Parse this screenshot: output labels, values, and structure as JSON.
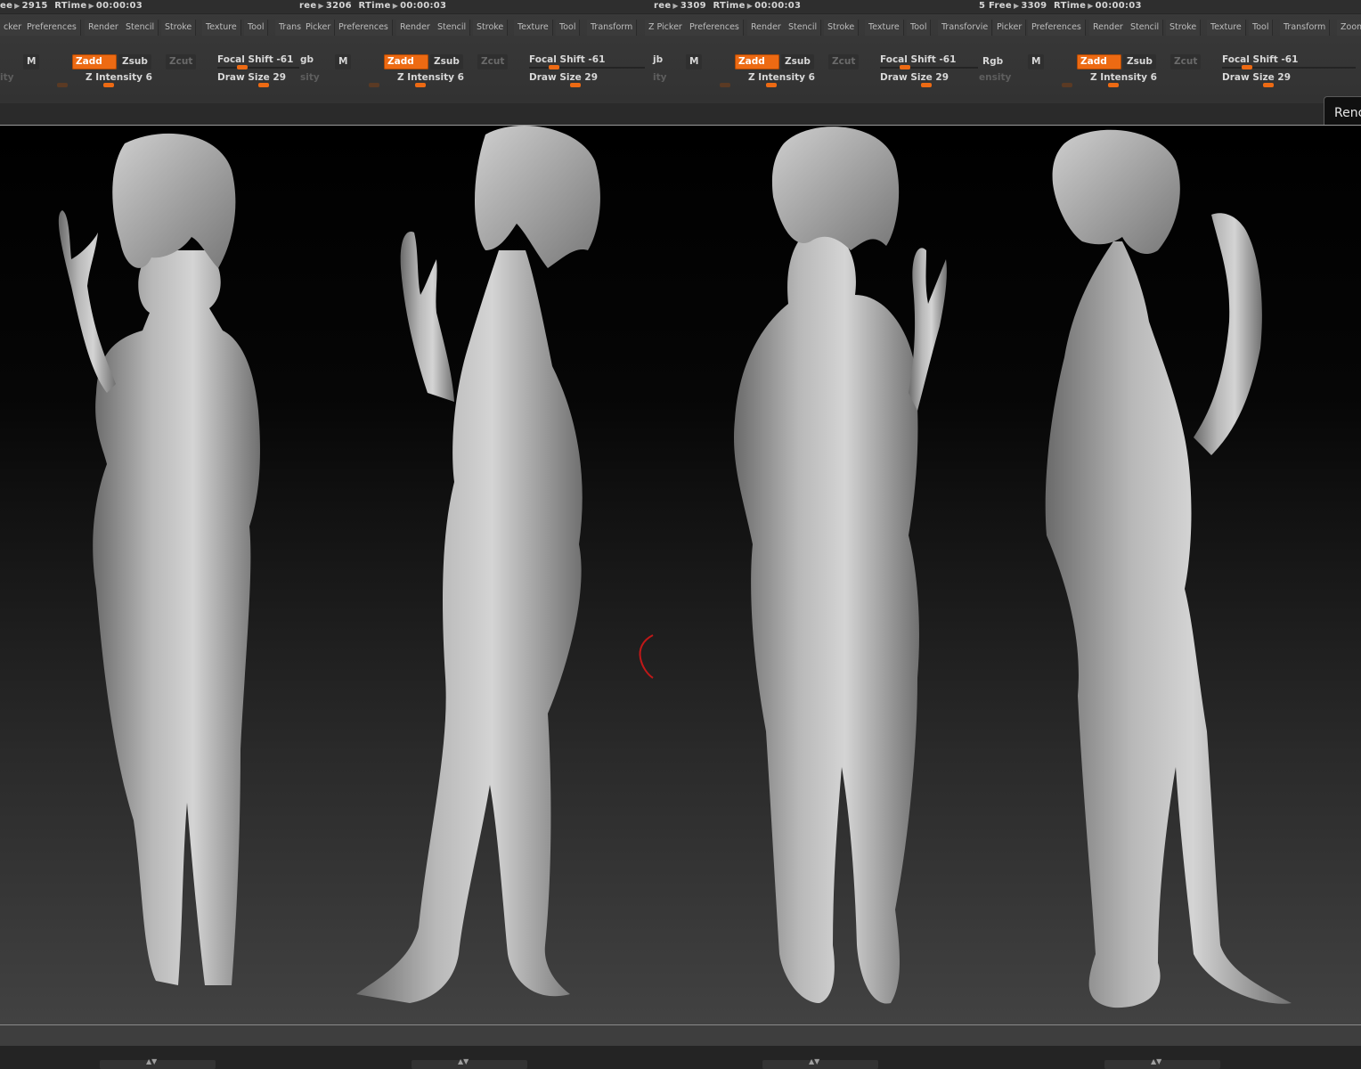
{
  "status": [
    {
      "free": "ee",
      "count": "2915",
      "rtime_label": "RTime",
      "time": "00:00:03"
    },
    {
      "free": "ree",
      "count": "3206",
      "rtime_label": "RTime",
      "time": "00:00:03"
    },
    {
      "free": "ree",
      "count": "3309",
      "rtime_label": "RTime",
      "time": "00:00:03"
    },
    {
      "free": "5 Free",
      "count": "3309",
      "rtime_label": "RTime",
      "time": "00:00:03"
    }
  ],
  "menus": [
    [
      "cker",
      "Preferences",
      "Render",
      "Stencil",
      "Stroke",
      "Texture",
      "Tool",
      "Trans"
    ],
    [
      "Picker",
      "Preferences",
      "Render",
      "Stencil",
      "Stroke",
      "Texture",
      "Tool",
      "Transform"
    ],
    [
      "Z Picker",
      "Preferences",
      "Render",
      "Stencil",
      "Stroke",
      "Texture",
      "Tool",
      "Transforvie"
    ],
    [
      "Picker",
      "Preferences",
      "Render",
      "Stencil",
      "Stroke",
      "Texture",
      "Tool",
      "Transform",
      "Zoom"
    ]
  ],
  "controls": {
    "rgb_partial": [
      "gb",
      "jb",
      "Rgb"
    ],
    "m_label": "M",
    "zadd_label": "Zadd",
    "zsub_label": "Zsub",
    "zcut_label": "Zcut",
    "focal_shift_label": "Focal Shift",
    "focal_shift_value": "-61",
    "z_intensity_label": "Z Intensity",
    "z_intensity_value": "6",
    "draw_size_label": "Draw Size",
    "draw_size_value": "29",
    "faded_left": [
      "ity",
      "sity",
      "ity",
      "ensity"
    ]
  },
  "render_button": "Renc",
  "colors": {
    "accent": "#ed6a13",
    "viewport_top": "#000000",
    "viewport_bottom": "#424242"
  },
  "viewport_views": [
    "front-view",
    "left-side-view",
    "back-view",
    "right-side-view"
  ]
}
